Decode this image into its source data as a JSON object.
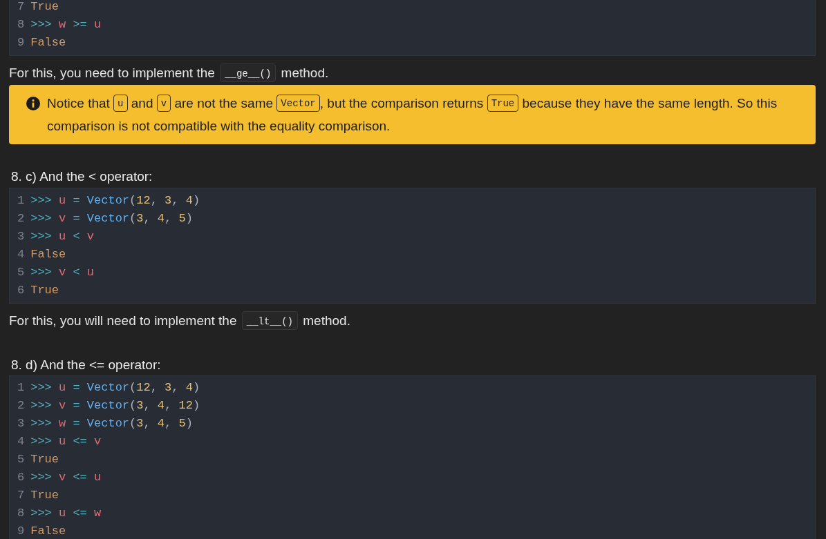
{
  "sections": [
    {
      "kind": "code",
      "lines": [
        {
          "number": "7",
          "tokens": [
            {
              "kind": "output",
              "text": "True"
            }
          ]
        },
        {
          "number": "8",
          "tokens": [
            {
              "kind": "prompt",
              "text": ">>>"
            },
            {
              "kind": "name",
              "text": " w"
            },
            {
              "kind": "operator",
              "text": " >="
            },
            {
              "kind": "name",
              "text": " u"
            }
          ]
        },
        {
          "number": "9",
          "tokens": [
            {
              "kind": "output",
              "text": "False"
            }
          ]
        }
      ]
    },
    {
      "kind": "paragraph",
      "parts": [
        {
          "kind": "text",
          "text": "For this, you need to implement the "
        },
        {
          "kind": "code",
          "text": "__ge__()"
        },
        {
          "kind": "text",
          "text": " method."
        }
      ]
    },
    {
      "kind": "note",
      "lines": [
        [
          {
            "kind": "text",
            "text": "Notice that "
          },
          {
            "kind": "code",
            "text": "u"
          },
          {
            "kind": "text",
            "text": " and "
          },
          {
            "kind": "code",
            "text": "v"
          },
          {
            "kind": "text",
            "text": " are not the same "
          },
          {
            "kind": "code",
            "text": "Vector"
          },
          {
            "kind": "text",
            "text": ", but the comparison returns "
          },
          {
            "kind": "code",
            "text": "True"
          },
          {
            "kind": "text",
            "text": " because they have the same length. So this"
          }
        ],
        [
          {
            "kind": "text",
            "text": "comparison is not compatible with the equality comparison."
          }
        ]
      ]
    },
    {
      "kind": "heading",
      "text": "8. c) And the < operator:"
    },
    {
      "kind": "code",
      "lines": [
        {
          "number": "1",
          "tokens": [
            {
              "kind": "prompt",
              "text": ">>>"
            },
            {
              "kind": "name",
              "text": " u"
            },
            {
              "kind": "operator",
              "text": " ="
            },
            {
              "kind": "func",
              "text": " Vector"
            },
            {
              "kind": "punct",
              "text": "("
            },
            {
              "kind": "number",
              "text": "12"
            },
            {
              "kind": "punct",
              "text": ","
            },
            {
              "kind": "number",
              "text": " 3"
            },
            {
              "kind": "punct",
              "text": ","
            },
            {
              "kind": "number",
              "text": " 4"
            },
            {
              "kind": "punct",
              "text": ")"
            }
          ]
        },
        {
          "number": "2",
          "tokens": [
            {
              "kind": "prompt",
              "text": ">>>"
            },
            {
              "kind": "name",
              "text": " v"
            },
            {
              "kind": "operator",
              "text": " ="
            },
            {
              "kind": "func",
              "text": " Vector"
            },
            {
              "kind": "punct",
              "text": "("
            },
            {
              "kind": "number",
              "text": "3"
            },
            {
              "kind": "punct",
              "text": ","
            },
            {
              "kind": "number",
              "text": " 4"
            },
            {
              "kind": "punct",
              "text": ","
            },
            {
              "kind": "number",
              "text": " 5"
            },
            {
              "kind": "punct",
              "text": ")"
            }
          ]
        },
        {
          "number": "3",
          "tokens": [
            {
              "kind": "prompt",
              "text": ">>>"
            },
            {
              "kind": "name",
              "text": " u"
            },
            {
              "kind": "operator",
              "text": " <"
            },
            {
              "kind": "name",
              "text": " v"
            }
          ]
        },
        {
          "number": "4",
          "tokens": [
            {
              "kind": "output",
              "text": "False"
            }
          ]
        },
        {
          "number": "5",
          "tokens": [
            {
              "kind": "prompt",
              "text": ">>>"
            },
            {
              "kind": "name",
              "text": " v"
            },
            {
              "kind": "operator",
              "text": " <"
            },
            {
              "kind": "name",
              "text": " u"
            }
          ]
        },
        {
          "number": "6",
          "tokens": [
            {
              "kind": "output",
              "text": "True"
            }
          ]
        }
      ]
    },
    {
      "kind": "paragraph",
      "parts": [
        {
          "kind": "text",
          "text": "For this, you will need to implement the "
        },
        {
          "kind": "code",
          "text": "__lt__()"
        },
        {
          "kind": "text",
          "text": " method."
        }
      ]
    },
    {
      "kind": "heading",
      "text": "8. d) And the <= operator:"
    },
    {
      "kind": "code",
      "lines": [
        {
          "number": "1",
          "tokens": [
            {
              "kind": "prompt",
              "text": ">>>"
            },
            {
              "kind": "name",
              "text": " u"
            },
            {
              "kind": "operator",
              "text": " ="
            },
            {
              "kind": "func",
              "text": " Vector"
            },
            {
              "kind": "punct",
              "text": "("
            },
            {
              "kind": "number",
              "text": "12"
            },
            {
              "kind": "punct",
              "text": ","
            },
            {
              "kind": "number",
              "text": " 3"
            },
            {
              "kind": "punct",
              "text": ","
            },
            {
              "kind": "number",
              "text": " 4"
            },
            {
              "kind": "punct",
              "text": ")"
            }
          ]
        },
        {
          "number": "2",
          "tokens": [
            {
              "kind": "prompt",
              "text": ">>>"
            },
            {
              "kind": "name",
              "text": " v"
            },
            {
              "kind": "operator",
              "text": " ="
            },
            {
              "kind": "func",
              "text": " Vector"
            },
            {
              "kind": "punct",
              "text": "("
            },
            {
              "kind": "number",
              "text": "3"
            },
            {
              "kind": "punct",
              "text": ","
            },
            {
              "kind": "number",
              "text": " 4"
            },
            {
              "kind": "punct",
              "text": ","
            },
            {
              "kind": "number",
              "text": " 12"
            },
            {
              "kind": "punct",
              "text": ")"
            }
          ]
        },
        {
          "number": "3",
          "tokens": [
            {
              "kind": "prompt",
              "text": ">>>"
            },
            {
              "kind": "name",
              "text": " w"
            },
            {
              "kind": "operator",
              "text": " ="
            },
            {
              "kind": "func",
              "text": " Vector"
            },
            {
              "kind": "punct",
              "text": "("
            },
            {
              "kind": "number",
              "text": "3"
            },
            {
              "kind": "punct",
              "text": ","
            },
            {
              "kind": "number",
              "text": " 4"
            },
            {
              "kind": "punct",
              "text": ","
            },
            {
              "kind": "number",
              "text": " 5"
            },
            {
              "kind": "punct",
              "text": ")"
            }
          ]
        },
        {
          "number": "4",
          "tokens": [
            {
              "kind": "prompt",
              "text": ">>>"
            },
            {
              "kind": "name",
              "text": " u"
            },
            {
              "kind": "operator",
              "text": " <="
            },
            {
              "kind": "name",
              "text": " v"
            }
          ]
        },
        {
          "number": "5",
          "tokens": [
            {
              "kind": "output",
              "text": "True"
            }
          ]
        },
        {
          "number": "6",
          "tokens": [
            {
              "kind": "prompt",
              "text": ">>>"
            },
            {
              "kind": "name",
              "text": " v"
            },
            {
              "kind": "operator",
              "text": " <="
            },
            {
              "kind": "name",
              "text": " u"
            }
          ]
        },
        {
          "number": "7",
          "tokens": [
            {
              "kind": "output",
              "text": "True"
            }
          ]
        },
        {
          "number": "8",
          "tokens": [
            {
              "kind": "prompt",
              "text": ">>>"
            },
            {
              "kind": "name",
              "text": " u"
            },
            {
              "kind": "operator",
              "text": " <="
            },
            {
              "kind": "name",
              "text": " w"
            }
          ]
        },
        {
          "number": "9",
          "tokens": [
            {
              "kind": "output",
              "text": "False"
            }
          ]
        }
      ]
    }
  ]
}
